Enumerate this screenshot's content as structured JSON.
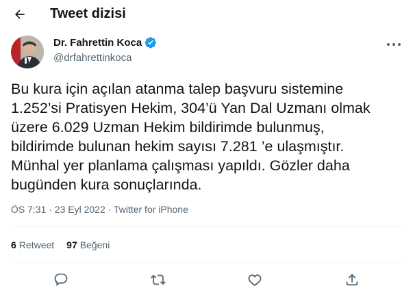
{
  "header": {
    "title": "Tweet dizisi"
  },
  "author": {
    "name": "Dr. Fahrettin Koca",
    "handle": "@drfahrettinkoca",
    "verified": true
  },
  "tweet": {
    "lines": [
      "Bu kura için açılan atanma talep başvuru sistemine",
      "1.252’si Pratisyen Hekim, 304’ü Yan Dal Uzmanı olmak",
      "üzere 6.029 Uzman Hekim bildirimde bulunmuş,",
      "bildirimde bulunan hekim sayısı 7.281 ’e ulaşmıştır.",
      "Münhal yer planlama çalışması yapıldı. Gözler daha",
      "bugünden kura sonuçlarında."
    ],
    "meta": "ÖS 7:31 · 23 Eyl 2022 · Twitter for iPhone"
  },
  "stats": {
    "retweets_count": "6",
    "retweets_label": "Retweet",
    "likes_count": "97",
    "likes_label": "Beğeni"
  },
  "colors": {
    "text": "#0f1419",
    "secondary": "#536471",
    "verified": "#1d9bf0",
    "divider": "#eff3f4"
  },
  "icons": [
    "back-arrow-icon",
    "verified-badge-icon",
    "more-icon",
    "reply-icon",
    "retweet-icon",
    "like-icon",
    "share-icon"
  ]
}
